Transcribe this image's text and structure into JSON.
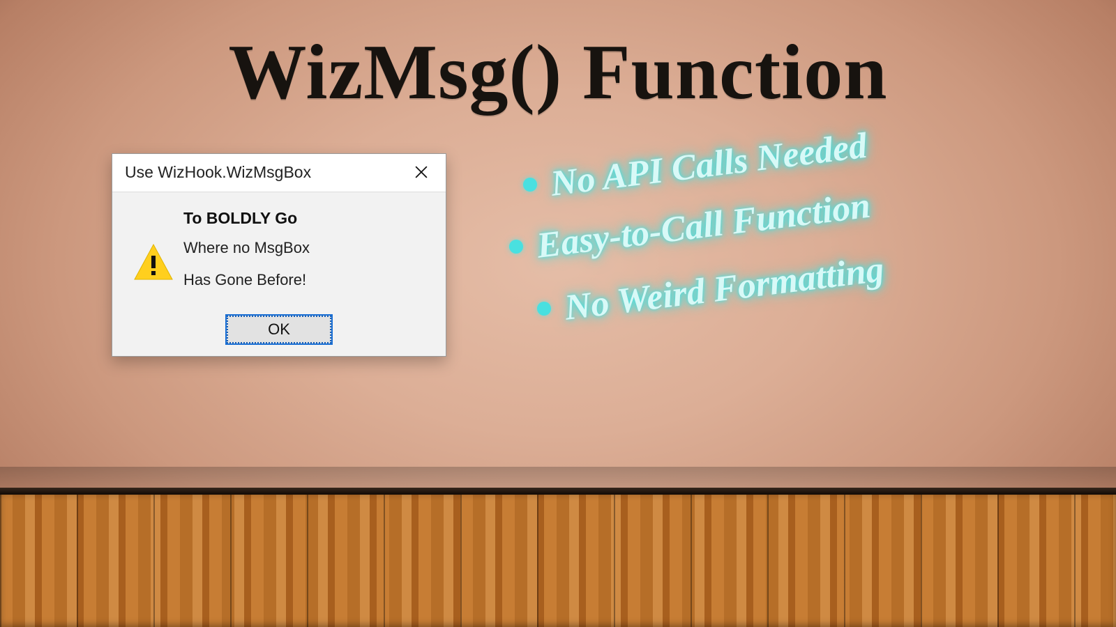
{
  "title": "WizMsg() Function",
  "msgbox": {
    "title": "Use WizHook.WizMsgBox",
    "bold_line": "To BOLDLY Go",
    "line1": "Where no MsgBox",
    "line2": "Has Gone Before!",
    "ok_label": "OK"
  },
  "bullets": [
    "No API Calls Needed",
    "Easy-to-Call Function",
    "No Weird Formatting"
  ],
  "colors": {
    "accent_glow": "#49e0e0",
    "title_color": "#17130f"
  }
}
